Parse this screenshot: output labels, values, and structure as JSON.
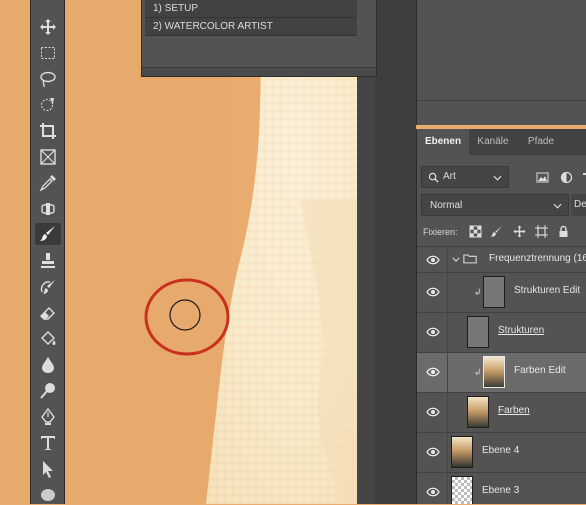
{
  "actions": {
    "items": [
      "1) SETUP",
      "2) WATERCOLOR ARTIST"
    ]
  },
  "toolbar": {
    "tools": [
      {
        "name": "move-tool"
      },
      {
        "name": "marquee-tool"
      },
      {
        "name": "lasso-tool"
      },
      {
        "name": "quick-selection-tool"
      },
      {
        "name": "crop-tool"
      },
      {
        "name": "frame-tool"
      },
      {
        "name": "eyedropper-tool"
      },
      {
        "name": "healing-brush-tool"
      },
      {
        "name": "brush-tool",
        "active": true
      },
      {
        "name": "stamp-tool"
      },
      {
        "name": "history-brush-tool"
      },
      {
        "name": "eraser-tool"
      },
      {
        "name": "paint-bucket-tool"
      },
      {
        "name": "blur-tool"
      },
      {
        "name": "dodge-tool"
      },
      {
        "name": "pen-tool"
      },
      {
        "name": "type-tool"
      },
      {
        "name": "path-selection-tool"
      },
      {
        "name": "ellipse-tool"
      }
    ]
  },
  "layers_panel": {
    "tabs": [
      "Ebenen",
      "Kanäle",
      "Pfade"
    ],
    "active_tab": "Ebenen",
    "filter_value": "Art",
    "blend_mode": "Normal",
    "opacity_label_partial": "De",
    "lock_label": "Fixieren:",
    "layers": [
      {
        "name": "Frequenztrennung (16",
        "type": "group",
        "visible": true
      },
      {
        "name": "Strukturen Edit",
        "type": "clipped",
        "visible": true
      },
      {
        "name": "Strukturen",
        "type": "layer",
        "visible": true,
        "underlined": true
      },
      {
        "name": "Farben Edit",
        "type": "clipped",
        "visible": true,
        "selected": true
      },
      {
        "name": "Farben",
        "type": "layer",
        "visible": true,
        "underlined": true
      },
      {
        "name": "Ebene 4",
        "type": "layer",
        "visible": true
      },
      {
        "name": "Ebene 3",
        "type": "layer",
        "visible": true
      }
    ]
  },
  "colors": {
    "canvas_orange": "#e9ab6e",
    "panel_bg": "#535353",
    "selection_row": "#6b6b6b",
    "annotation_red": "#c9311f"
  }
}
